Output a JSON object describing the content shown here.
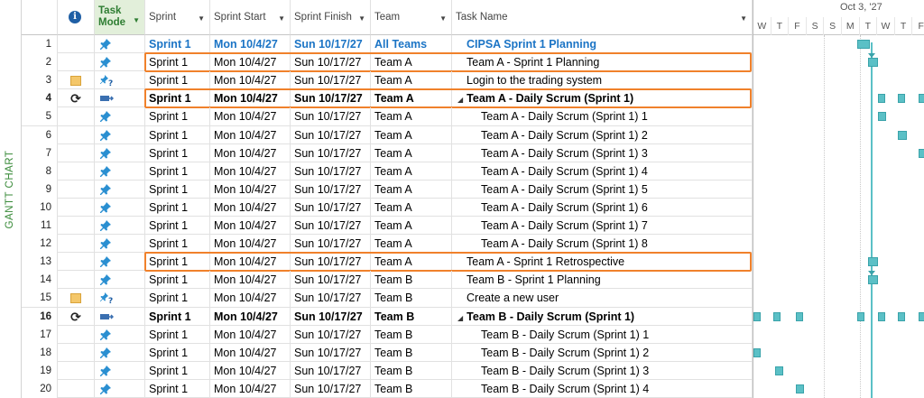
{
  "side_label": "GANTT CHART",
  "headers": {
    "mode": "Task Mode",
    "sprint": "Sprint",
    "sprint_start": "Sprint Start",
    "sprint_finish": "Sprint Finish",
    "team": "Team",
    "task_name": "Task Name",
    "info": "i"
  },
  "timescale": {
    "week_label": "Oct 3, '27",
    "days": [
      "W",
      "T",
      "F",
      "S",
      "S",
      "M",
      "T",
      "W",
      "T",
      "F"
    ]
  },
  "rows": [
    {
      "id": "1",
      "ind": "",
      "mode": "pin",
      "sprint": "Sprint 1",
      "start": "Mon 10/4/27",
      "finish": "Sun 10/17/27",
      "team": "All Teams",
      "task": "CIPSA Sprint 1 Planning",
      "style": "project",
      "level": 1
    },
    {
      "id": "2",
      "ind": "",
      "mode": "pin",
      "sprint": "Sprint 1",
      "start": "Mon 10/4/27",
      "finish": "Sun 10/17/27",
      "team": "Team A",
      "task": "Team A - Sprint 1 Planning",
      "style": "normal",
      "level": 1
    },
    {
      "id": "3",
      "ind": "note",
      "mode": "manual",
      "sprint": "Sprint 1",
      "start": "Mon 10/4/27",
      "finish": "Sun 10/17/27",
      "team": "Team A",
      "task": "Login to the trading system",
      "style": "normal",
      "level": 1
    },
    {
      "id": "4",
      "ind": "recur",
      "mode": "auto",
      "sprint": "Sprint 1",
      "start": "Mon 10/4/27",
      "finish": "Sun 10/17/27",
      "team": "Team A",
      "task": "Team A - Daily Scrum (Sprint 1)",
      "style": "summary",
      "level": 1
    },
    {
      "id": "5",
      "ind": "",
      "mode": "pin",
      "sprint": "Sprint 1",
      "start": "Mon 10/4/27",
      "finish": "Sun 10/17/27",
      "team": "Team A",
      "task": "Team A - Daily Scrum (Sprint 1) 1",
      "style": "normal",
      "level": 2
    },
    {
      "id": "6",
      "ind": "",
      "mode": "pin",
      "sprint": "Sprint 1",
      "start": "Mon 10/4/27",
      "finish": "Sun 10/17/27",
      "team": "Team A",
      "task": "Team A - Daily Scrum (Sprint 1) 2",
      "style": "normal",
      "level": 2
    },
    {
      "id": "7",
      "ind": "",
      "mode": "pin",
      "sprint": "Sprint 1",
      "start": "Mon 10/4/27",
      "finish": "Sun 10/17/27",
      "team": "Team A",
      "task": "Team A - Daily Scrum (Sprint 1) 3",
      "style": "normal",
      "level": 2
    },
    {
      "id": "8",
      "ind": "",
      "mode": "pin",
      "sprint": "Sprint 1",
      "start": "Mon 10/4/27",
      "finish": "Sun 10/17/27",
      "team": "Team A",
      "task": "Team A - Daily Scrum (Sprint 1) 4",
      "style": "normal",
      "level": 2
    },
    {
      "id": "9",
      "ind": "",
      "mode": "pin",
      "sprint": "Sprint 1",
      "start": "Mon 10/4/27",
      "finish": "Sun 10/17/27",
      "team": "Team A",
      "task": "Team A - Daily Scrum (Sprint 1) 5",
      "style": "normal",
      "level": 2
    },
    {
      "id": "10",
      "ind": "",
      "mode": "pin",
      "sprint": "Sprint 1",
      "start": "Mon 10/4/27",
      "finish": "Sun 10/17/27",
      "team": "Team A",
      "task": "Team A - Daily Scrum (Sprint 1) 6",
      "style": "normal",
      "level": 2
    },
    {
      "id": "11",
      "ind": "",
      "mode": "pin",
      "sprint": "Sprint 1",
      "start": "Mon 10/4/27",
      "finish": "Sun 10/17/27",
      "team": "Team A",
      "task": "Team A - Daily Scrum (Sprint 1) 7",
      "style": "normal",
      "level": 2
    },
    {
      "id": "12",
      "ind": "",
      "mode": "pin",
      "sprint": "Sprint 1",
      "start": "Mon 10/4/27",
      "finish": "Sun 10/17/27",
      "team": "Team A",
      "task": "Team A - Daily Scrum (Sprint 1) 8",
      "style": "normal",
      "level": 2
    },
    {
      "id": "13",
      "ind": "",
      "mode": "pin",
      "sprint": "Sprint 1",
      "start": "Mon 10/4/27",
      "finish": "Sun 10/17/27",
      "team": "Team A",
      "task": "Team A - Sprint 1 Retrospective",
      "style": "normal",
      "level": 1
    },
    {
      "id": "14",
      "ind": "",
      "mode": "pin",
      "sprint": "Sprint 1",
      "start": "Mon 10/4/27",
      "finish": "Sun 10/17/27",
      "team": "Team B",
      "task": "Team B - Sprint 1 Planning",
      "style": "normal",
      "level": 1
    },
    {
      "id": "15",
      "ind": "note",
      "mode": "manual",
      "sprint": "Sprint 1",
      "start": "Mon 10/4/27",
      "finish": "Sun 10/17/27",
      "team": "Team B",
      "task": "Create a new user",
      "style": "normal",
      "level": 1
    },
    {
      "id": "16",
      "ind": "recur",
      "mode": "auto",
      "sprint": "Sprint 1",
      "start": "Mon 10/4/27",
      "finish": "Sun 10/17/27",
      "team": "Team B",
      "task": "Team B - Daily Scrum (Sprint 1)",
      "style": "summary",
      "level": 1
    },
    {
      "id": "17",
      "ind": "",
      "mode": "pin",
      "sprint": "Sprint 1",
      "start": "Mon 10/4/27",
      "finish": "Sun 10/17/27",
      "team": "Team B",
      "task": "Team B - Daily Scrum (Sprint 1) 1",
      "style": "normal",
      "level": 2
    },
    {
      "id": "18",
      "ind": "",
      "mode": "pin",
      "sprint": "Sprint 1",
      "start": "Mon 10/4/27",
      "finish": "Sun 10/17/27",
      "team": "Team B",
      "task": "Team B - Daily Scrum (Sprint 1) 2",
      "style": "normal",
      "level": 2
    },
    {
      "id": "19",
      "ind": "",
      "mode": "pin",
      "sprint": "Sprint 1",
      "start": "Mon 10/4/27",
      "finish": "Sun 10/17/27",
      "team": "Team B",
      "task": "Team B - Daily Scrum (Sprint 1) 3",
      "style": "normal",
      "level": 2
    },
    {
      "id": "20",
      "ind": "",
      "mode": "pin",
      "sprint": "Sprint 1",
      "start": "Mon 10/4/27",
      "finish": "Sun 10/17/27",
      "team": "Team B",
      "task": "Team B - Daily Scrum (Sprint 1) 4",
      "style": "normal",
      "level": 2
    }
  ],
  "highlighted_rows": [
    "2",
    "4",
    "13"
  ],
  "colors": {
    "highlight": "#f0812b",
    "project_text": "#1b74c5",
    "gantt_bar": "#5bc0c6",
    "mode_header_bg": "#e2efda"
  }
}
